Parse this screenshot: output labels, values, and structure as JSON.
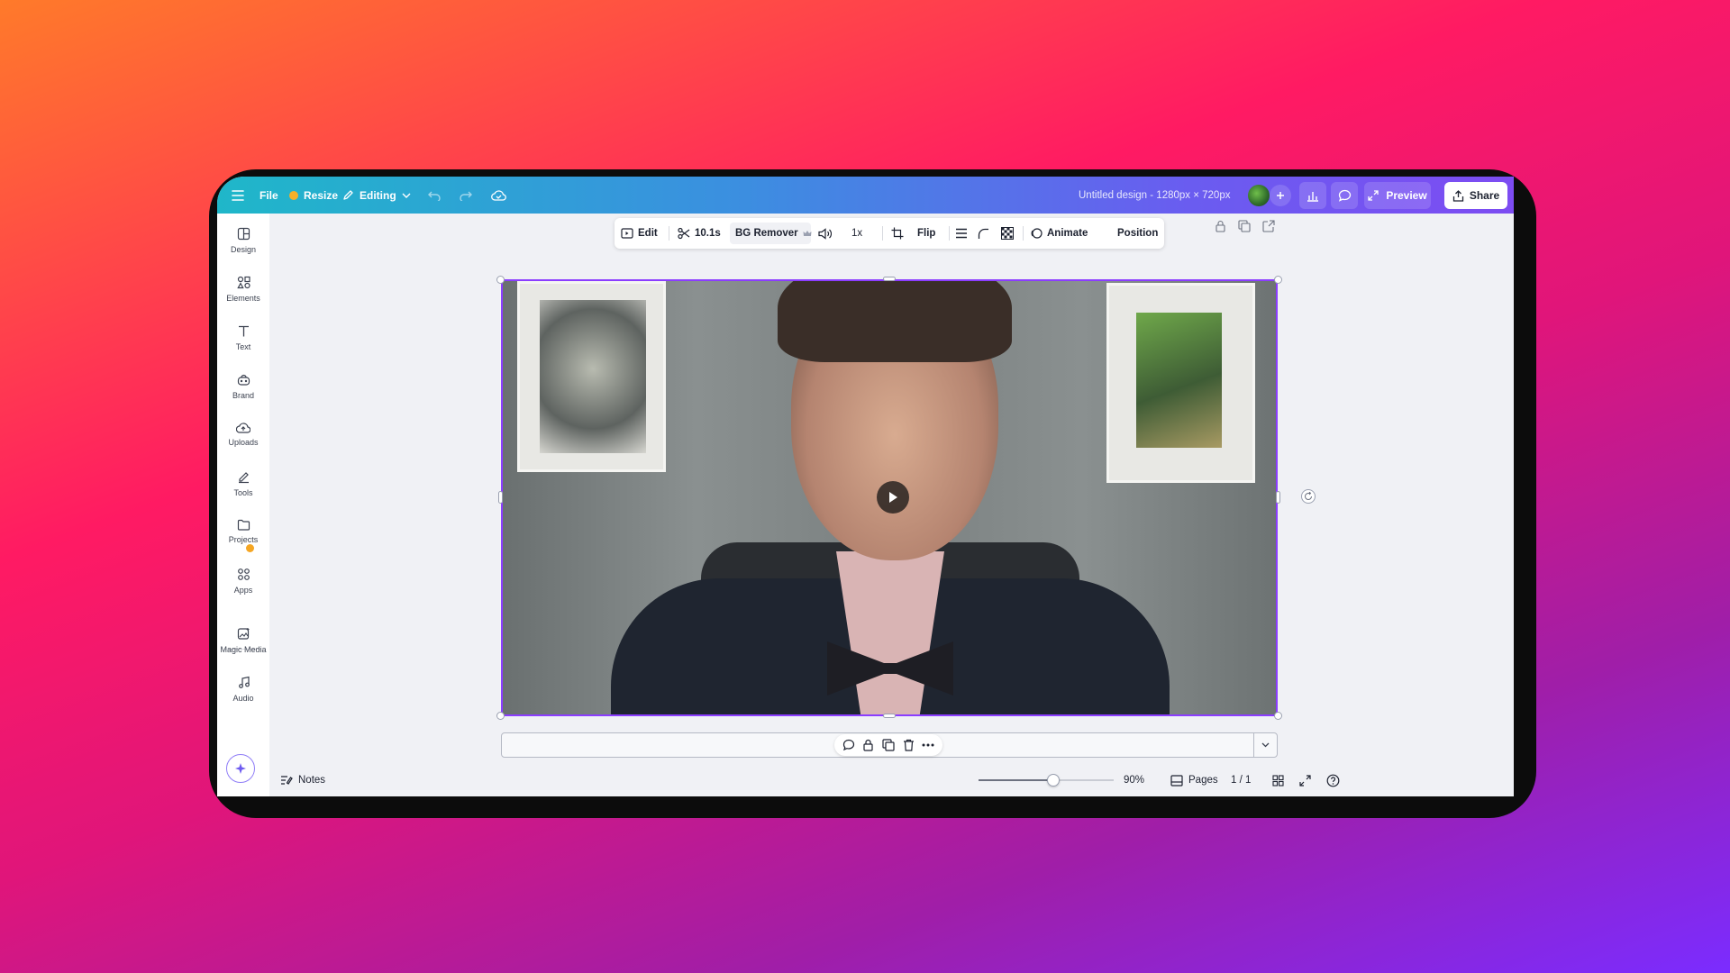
{
  "topbar": {
    "file_label": "File",
    "resize_label": "Resize",
    "editing_label": "Editing",
    "design_title": "Untitled design - 1280px × 720px",
    "preview_label": "Preview",
    "share_label": "Share"
  },
  "sidebar": {
    "items": [
      {
        "label": "Design",
        "icon": "layout-icon"
      },
      {
        "label": "Elements",
        "icon": "shapes-icon"
      },
      {
        "label": "Text",
        "icon": "text-icon"
      },
      {
        "label": "Brand",
        "icon": "brand-icon"
      },
      {
        "label": "Uploads",
        "icon": "cloud-upload-icon"
      },
      {
        "label": "Tools",
        "icon": "pen-icon"
      },
      {
        "label": "Projects",
        "icon": "folder-icon"
      },
      {
        "label": "Apps",
        "icon": "apps-icon"
      },
      {
        "label": "Magic Media",
        "icon": "magic-image-icon"
      },
      {
        "label": "Audio",
        "icon": "music-note-icon"
      }
    ]
  },
  "context_toolbar": {
    "edit_label": "Edit",
    "duration_label": "10.1s",
    "bg_remover_label": "BG Remover",
    "speed_label": "1x",
    "flip_label": "Flip",
    "animate_label": "Animate",
    "position_label": "Position"
  },
  "footer": {
    "notes_label": "Notes",
    "zoom_value": 0.55,
    "zoom_label": "90%",
    "pages_label": "Pages",
    "page_count": "1 / 1"
  },
  "colors": {
    "accent": "#8b3dff",
    "topbar_start": "#1fb7c9",
    "topbar_end": "#7d4cf2"
  }
}
